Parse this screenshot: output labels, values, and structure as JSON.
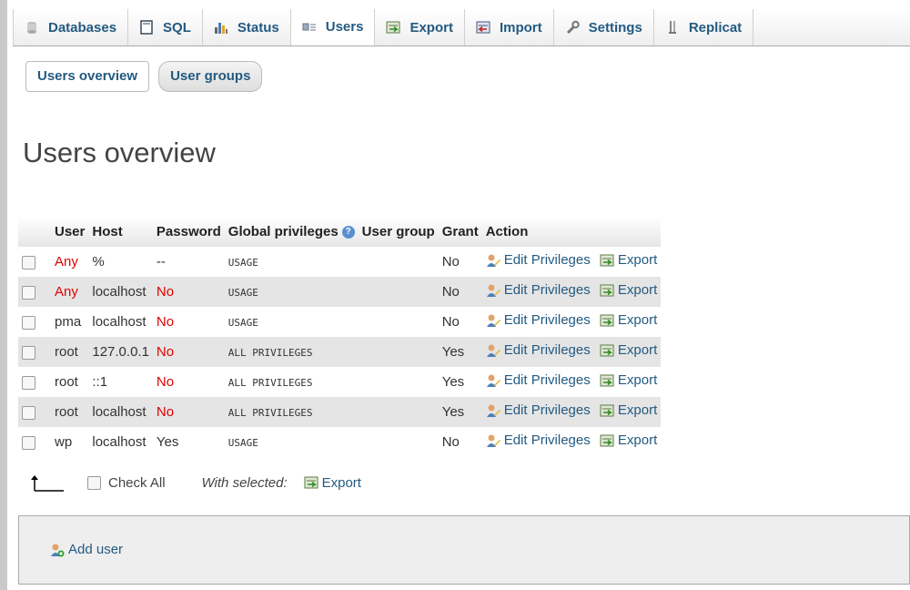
{
  "nav": {
    "tabs": [
      {
        "label": "Databases",
        "icon": "database-icon"
      },
      {
        "label": "SQL",
        "icon": "sql-icon"
      },
      {
        "label": "Status",
        "icon": "status-icon"
      },
      {
        "label": "Users",
        "icon": "users-icon",
        "active": true
      },
      {
        "label": "Export",
        "icon": "export-icon"
      },
      {
        "label": "Import",
        "icon": "import-icon"
      },
      {
        "label": "Settings",
        "icon": "settings-icon"
      },
      {
        "label": "Replicat",
        "icon": "replication-icon"
      }
    ]
  },
  "subtabs": {
    "overview": "Users overview",
    "groups": "User groups"
  },
  "page_title": "Users overview",
  "table": {
    "headers": {
      "user": "User",
      "host": "Host",
      "password": "Password",
      "global_privileges": "Global privileges",
      "user_group": "User group",
      "grant": "Grant",
      "action": "Action"
    },
    "rows": [
      {
        "user": "Any",
        "host": "%",
        "password": "--",
        "privileges": "USAGE",
        "user_group": "",
        "grant": "No"
      },
      {
        "user": "Any",
        "host": "localhost",
        "password": "No",
        "privileges": "USAGE",
        "user_group": "",
        "grant": "No"
      },
      {
        "user": "pma",
        "host": "localhost",
        "password": "No",
        "privileges": "USAGE",
        "user_group": "",
        "grant": "No"
      },
      {
        "user": "root",
        "host": "127.0.0.1",
        "password": "No",
        "privileges": "ALL PRIVILEGES",
        "user_group": "",
        "grant": "Yes"
      },
      {
        "user": "root",
        "host": "::1",
        "password": "No",
        "privileges": "ALL PRIVILEGES",
        "user_group": "",
        "grant": "Yes"
      },
      {
        "user": "root",
        "host": "localhost",
        "password": "No",
        "privileges": "ALL PRIVILEGES",
        "user_group": "",
        "grant": "Yes"
      },
      {
        "user": "wp",
        "host": "localhost",
        "password": "Yes",
        "privileges": "USAGE",
        "user_group": "",
        "grant": "No"
      }
    ],
    "action_edit": "Edit Privileges",
    "action_export": "Export"
  },
  "bulk": {
    "check_all": "Check All",
    "with_selected": "With selected:",
    "export": "Export"
  },
  "add_user": "Add user",
  "colors": {
    "link": "#235a81",
    "warning": "#e00000",
    "row_alt": "#e5e5e5"
  }
}
